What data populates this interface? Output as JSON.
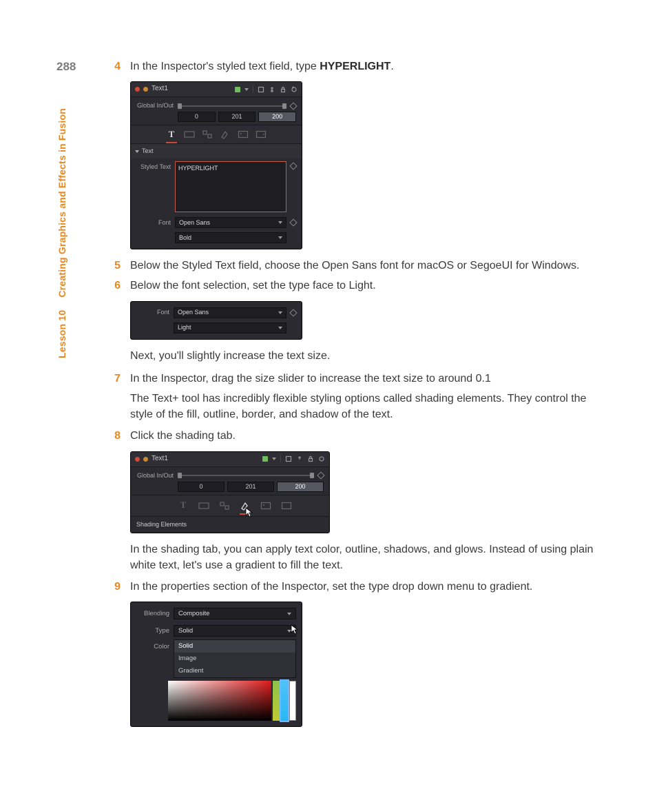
{
  "page_number": "288",
  "sidebar": {
    "lesson": "Lesson 10",
    "title": "Creating Graphics and Effects in Fusion"
  },
  "steps": {
    "s4": {
      "num": "4",
      "text_a": "In the Inspector's styled text field, type ",
      "bold": "HYPERLIGHT",
      "text_b": "."
    },
    "s5": {
      "num": "5",
      "text": "Below the Styled Text field, choose the Open Sans font for macOS or SegoeUI for Windows."
    },
    "s6": {
      "num": "6",
      "text": "Below the font selection, set the type face to Light."
    },
    "s7": {
      "num": "7",
      "text": "In the Inspector, drag the size slider to increase the text size to around 0.1"
    },
    "s8": {
      "num": "8",
      "text": "Click the shading tab."
    },
    "s9": {
      "num": "9",
      "text": "In the properties section of the Inspector, set the type drop down menu to gradient."
    }
  },
  "paras": {
    "p1": "Next, you'll slightly increase the text size.",
    "p2": "The Text+ tool has incredibly flexible styling options called shading elements. They control the style of the fill, outline, border, and shadow of the text.",
    "p3": "In the shading tab, you can apply text color, outline, shadows, and glows. Instead of using plain white text, let's use a gradient to fill the text."
  },
  "panel1": {
    "title": "Text1",
    "global_inout": "Global In/Out",
    "range_start": "0",
    "range_mid": "201",
    "range_end": "200",
    "section": "Text",
    "styled_text_label": "Styled Text",
    "styled_text_value": "HYPERLIGHT",
    "font_label": "Font",
    "font_value": "Open Sans",
    "weight_value": "Bold"
  },
  "panel2": {
    "font_label": "Font",
    "font_value": "Open Sans",
    "weight_value": "Light"
  },
  "panel3": {
    "title": "Text1",
    "global_inout": "Global In/Out",
    "range_start": "0",
    "range_mid": "201",
    "range_end": "200",
    "tooltip": "Shading Elements"
  },
  "panel4": {
    "blending_label": "Blending",
    "blending_value": "Composite",
    "type_label": "Type",
    "type_value": "Solid",
    "color_label": "Color",
    "options": {
      "o1": "Solid",
      "o2": "Image",
      "o3": "Gradient"
    }
  }
}
